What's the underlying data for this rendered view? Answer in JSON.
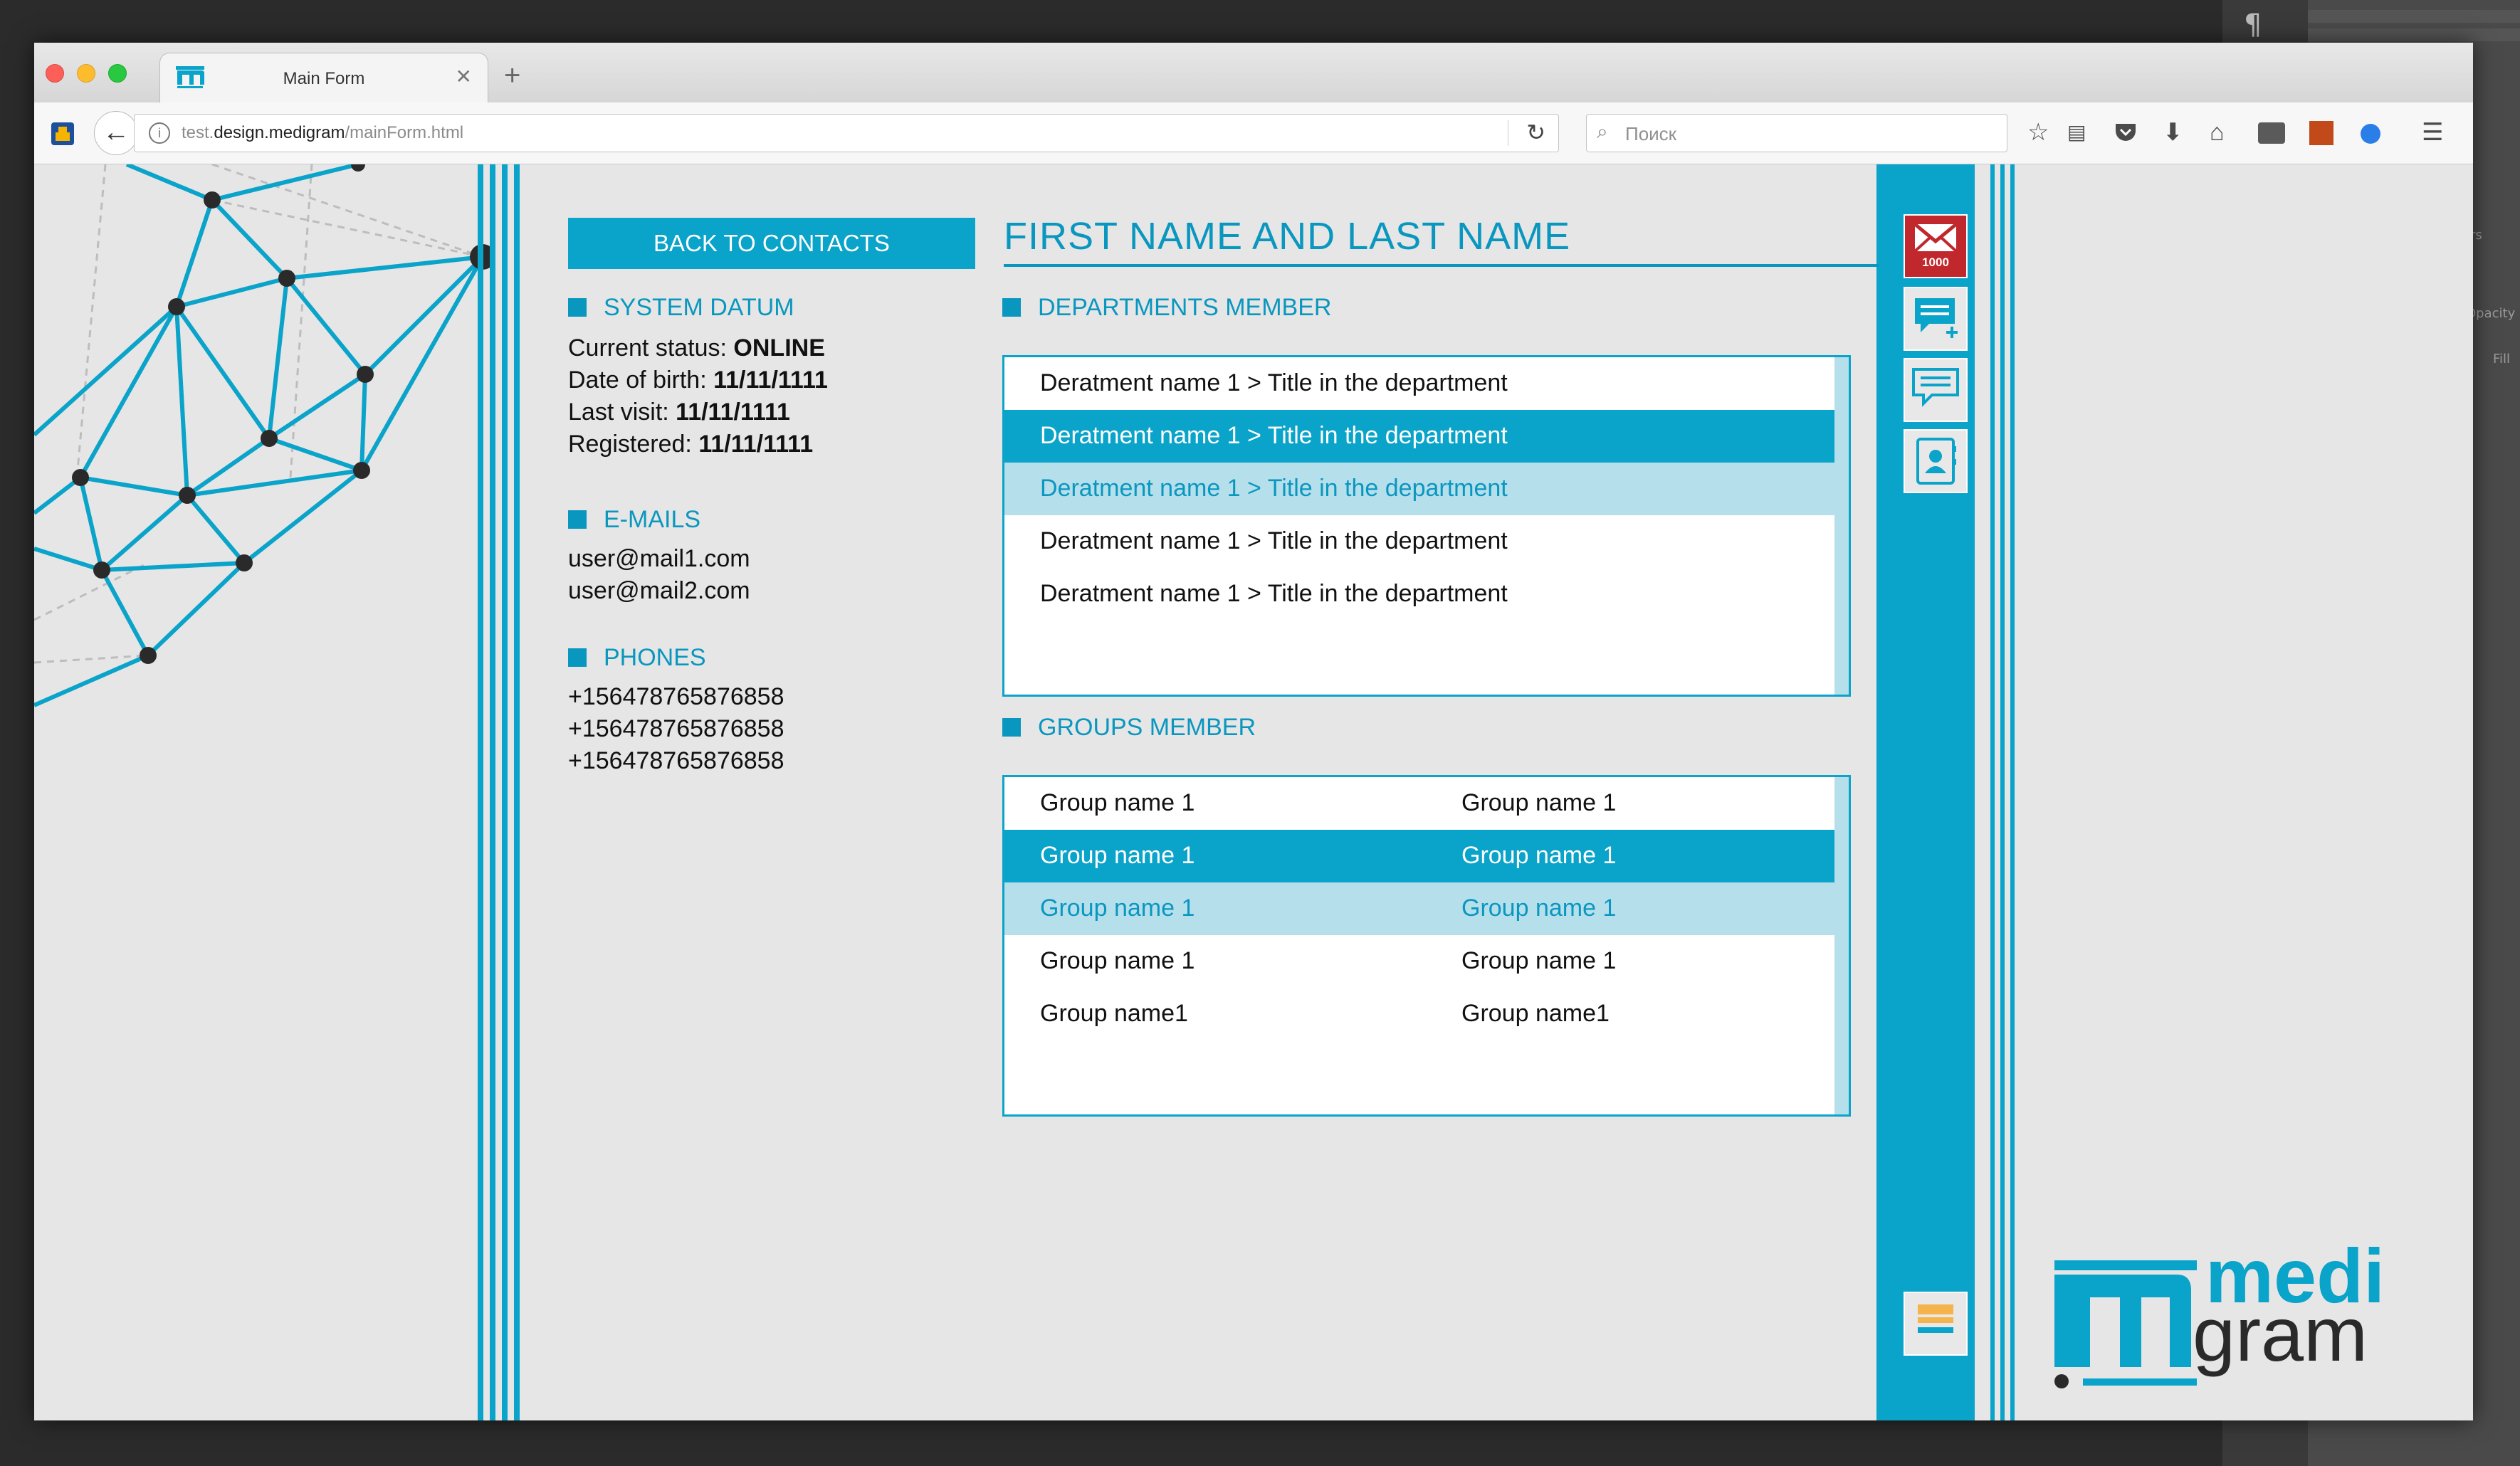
{
  "window": {
    "tab_title": "Main Form",
    "close_glyph": "✕",
    "new_tab_glyph": "+",
    "url_host_prefix": "test.",
    "url_host": "design.medigram",
    "url_path": "/mainForm.html",
    "search_placeholder": "Поиск"
  },
  "toolbar_icons": [
    "star-icon",
    "reading-list-icon",
    "pocket-icon",
    "download-icon",
    "home-icon",
    "screenshot-icon",
    "extension-icon",
    "chat-icon",
    "menu-icon"
  ],
  "background_app": {
    "glyph1": "¶",
    "label_rs": "rs",
    "label_opacity": "Opacity",
    "label_fill": "Fill"
  },
  "actions": {
    "back_to_contacts": "BACK TO CONTACTS"
  },
  "contact": {
    "full_name": "FIRST NAME AND LAST NAME"
  },
  "system_datum": {
    "heading": "SYSTEM DATUM",
    "status_label": "Current status: ",
    "status_value": "ONLINE",
    "dob_label": "Date of birth: ",
    "dob_value": "11/11/1111",
    "last_visit_label": "Last visit: ",
    "last_visit_value": "11/11/1111",
    "registered_label": "Registered: ",
    "registered_value": "11/11/1111"
  },
  "emails": {
    "heading": "E-MAILS",
    "items": [
      "user@mail1.com",
      "user@mail2.com"
    ]
  },
  "phones": {
    "heading": "PHONES",
    "items": [
      "+156478765876858",
      "+156478765876858",
      "+156478765876858"
    ]
  },
  "departments": {
    "heading": "DEPARTMENTS MEMBER",
    "rows": [
      "Deratment name 1 > Title in the department",
      "Deratment name 1 > Title in the department",
      "Deratment name 1 > Title in the department",
      "Deratment name 1 > Title in the department",
      "Deratment name 1 > Title in the department"
    ]
  },
  "groups": {
    "heading": "GROUPS MEMBER",
    "rows": [
      [
        "Group name 1",
        "Group name 1"
      ],
      [
        "Group name 1",
        "Group name 1"
      ],
      [
        "Group name 1",
        "Group name 1"
      ],
      [
        "Group name 1",
        "Group name 1"
      ],
      [
        "Group name1",
        "Group name1"
      ]
    ]
  },
  "sidebar": {
    "mail_count": "1000"
  },
  "brand": {
    "logo_top": "medi",
    "logo_bottom": "gram",
    "accent": "#0aa3c9",
    "text_dark": "#2a2a2a"
  }
}
